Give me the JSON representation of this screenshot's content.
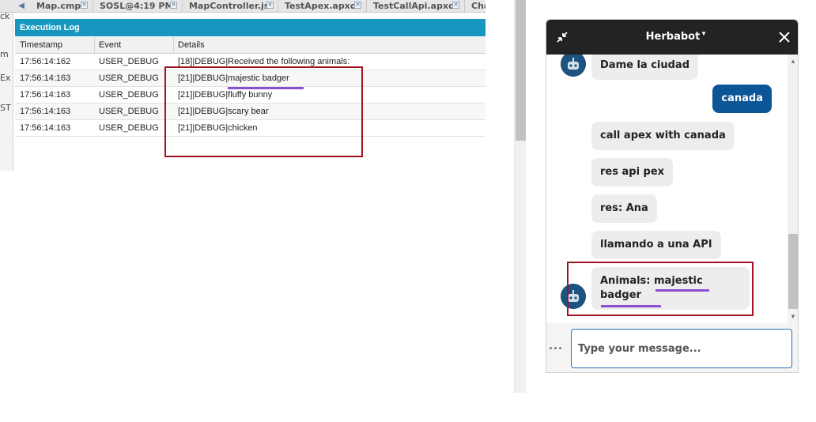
{
  "ide": {
    "left_strip": [
      "ck",
      "m",
      "Ex",
      "ST"
    ],
    "tabs": [
      {
        "label": "Map.cmp"
      },
      {
        "label": "SOSL@4:19 PM"
      },
      {
        "label": "MapController.js"
      },
      {
        "label": "TestApex.apxc"
      },
      {
        "label": "TestCallApi.apxc"
      },
      {
        "label": "Cha"
      }
    ],
    "log": {
      "title": "Execution Log",
      "columns": [
        "Timestamp",
        "Event",
        "Details"
      ],
      "rows": [
        {
          "timestamp": "17:56:14:162",
          "event": "USER_DEBUG",
          "details": "[18]|DEBUG|Received the following animals:"
        },
        {
          "timestamp": "17:56:14:163",
          "event": "USER_DEBUG",
          "details": "[21]|DEBUG|majestic badger"
        },
        {
          "timestamp": "17:56:14:163",
          "event": "USER_DEBUG",
          "details": "[21]|DEBUG|fluffy bunny"
        },
        {
          "timestamp": "17:56:14:163",
          "event": "USER_DEBUG",
          "details": "[21]|DEBUG|scary bear"
        },
        {
          "timestamp": "17:56:14:163",
          "event": "USER_DEBUG",
          "details": "[21]|DEBUG|chicken"
        }
      ]
    }
  },
  "chat": {
    "title": "Herbabot",
    "messages": [
      {
        "from": "bot",
        "text": "Dame la ciudad"
      },
      {
        "from": "user",
        "text": "canada"
      },
      {
        "from": "bot",
        "text": "call apex with  canada"
      },
      {
        "from": "bot",
        "text": "res api pex"
      },
      {
        "from": "bot",
        "text": "res: Ana"
      },
      {
        "from": "bot",
        "text": "llamando a una API"
      },
      {
        "from": "bot",
        "text": "Animals: majestic\nbadger"
      }
    ],
    "input_placeholder": "Type your message...",
    "more_label": "..."
  },
  "colors": {
    "log_header": "#1797c0",
    "chat_header": "#232323",
    "user_bubble": "#0c5597",
    "bot_bubble": "#ededed",
    "highlight_box": "#a0141f",
    "highlight_underline": "#8c4fcf"
  }
}
